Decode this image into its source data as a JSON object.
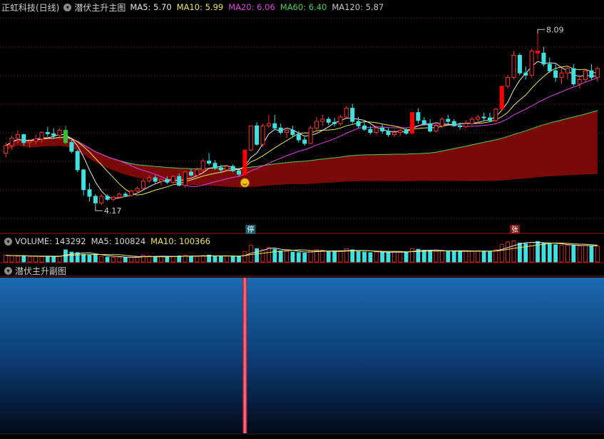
{
  "header": {
    "title": "正虹科技(日线)",
    "indicator_name": "潜伏主升主图",
    "ma_labels": [
      {
        "text": "MA5: 5.70",
        "color": "#e8e8e8"
      },
      {
        "text": "MA10: 5.99",
        "color": "#e8e85a"
      },
      {
        "text": "MA20: 6.06",
        "color": "#e040e0"
      },
      {
        "text": "MA60: 6.40",
        "color": "#50d050"
      },
      {
        "text": "MA120: 5.87",
        "color": "#c8c8c8"
      }
    ]
  },
  "volume_header": {
    "volume": "VOLUME: 143292",
    "ma5": "MA5: 100824",
    "ma10": "MA10: 100366"
  },
  "sub_header": {
    "name": "潜伏主升副图"
  },
  "annotations": {
    "high_label": "8.09",
    "low_label": "4.17",
    "stop_marker": "停",
    "rise_marker": "张"
  },
  "colors": {
    "up": "#ff3030",
    "down": "#40e0e0",
    "limit_up": "#ff0000",
    "limit_down": "#30c030",
    "ma5": "#e8e8e8",
    "ma10": "#e8e85a",
    "ma20": "#e040e0",
    "ma60": "#50d050",
    "band_fill": "#7a0a0a",
    "background": "#000000"
  },
  "chart_data": {
    "type": "candlestick",
    "price_range": [
      3.8,
      8.5
    ],
    "candles": [
      [
        5.38,
        5.62,
        5.28,
        5.55
      ],
      [
        5.55,
        5.78,
        5.46,
        5.72
      ],
      [
        5.72,
        5.9,
        5.6,
        5.8
      ],
      [
        5.8,
        5.82,
        5.55,
        5.62
      ],
      [
        5.62,
        5.7,
        5.5,
        5.65
      ],
      [
        5.65,
        5.8,
        5.58,
        5.7
      ],
      [
        5.7,
        5.88,
        5.62,
        5.85
      ],
      [
        5.85,
        5.98,
        5.75,
        5.82
      ],
      [
        5.82,
        5.95,
        5.7,
        5.78
      ],
      [
        5.78,
        5.95,
        5.7,
        5.9
      ],
      [
        5.9,
        6.0,
        5.58,
        5.62
      ],
      [
        5.62,
        5.68,
        5.38,
        5.42
      ],
      [
        5.42,
        5.45,
        4.95,
        5.0
      ],
      [
        5.0,
        5.02,
        4.42,
        4.55
      ],
      [
        4.55,
        4.7,
        4.28,
        4.4
      ],
      [
        4.4,
        4.45,
        4.17,
        4.25
      ],
      [
        4.25,
        4.45,
        4.2,
        4.4
      ],
      [
        4.4,
        4.45,
        4.3,
        4.33
      ],
      [
        4.33,
        4.4,
        4.28,
        4.38
      ],
      [
        4.38,
        4.48,
        4.35,
        4.45
      ],
      [
        4.45,
        4.5,
        4.38,
        4.42
      ],
      [
        4.42,
        4.55,
        4.4,
        4.52
      ],
      [
        4.52,
        4.62,
        4.46,
        4.58
      ],
      [
        4.58,
        4.8,
        4.55,
        4.75
      ],
      [
        4.75,
        4.88,
        4.7,
        4.82
      ],
      [
        4.82,
        4.88,
        4.7,
        4.74
      ],
      [
        4.74,
        4.8,
        4.65,
        4.78
      ],
      [
        4.78,
        4.85,
        4.68,
        4.72
      ],
      [
        4.72,
        4.88,
        4.68,
        4.85
      ],
      [
        4.85,
        4.92,
        4.62,
        4.65
      ],
      [
        4.65,
        4.98,
        4.6,
        4.95
      ],
      [
        4.95,
        5.02,
        4.85,
        4.88
      ],
      [
        4.88,
        5.05,
        4.82,
        5.0
      ],
      [
        5.0,
        5.25,
        4.95,
        5.2
      ],
      [
        5.2,
        5.38,
        5.1,
        5.15
      ],
      [
        5.15,
        5.22,
        5.0,
        5.05
      ],
      [
        5.05,
        5.12,
        4.95,
        5.0
      ],
      [
        5.0,
        5.1,
        4.98,
        5.08
      ],
      [
        5.08,
        5.12,
        4.95,
        4.98
      ],
      [
        4.98,
        5.02,
        4.85,
        4.9
      ],
      [
        4.9,
        5.45,
        4.88,
        5.45
      ],
      [
        5.45,
        6.0,
        5.42,
        6.0
      ],
      [
        6.0,
        6.08,
        5.55,
        5.58
      ],
      [
        5.58,
        6.05,
        5.52,
        6.0
      ],
      [
        6.0,
        6.25,
        5.95,
        6.05
      ],
      [
        6.05,
        6.25,
        5.9,
        5.95
      ],
      [
        5.95,
        6.05,
        5.8,
        5.85
      ],
      [
        5.85,
        5.95,
        5.72,
        5.9
      ],
      [
        5.9,
        6.0,
        5.75,
        5.8
      ],
      [
        5.8,
        5.88,
        5.62,
        5.68
      ],
      [
        5.68,
        5.75,
        5.55,
        5.6
      ],
      [
        5.6,
        6.0,
        5.58,
        5.95
      ],
      [
        5.95,
        6.2,
        5.9,
        6.1
      ],
      [
        6.1,
        6.25,
        6.0,
        6.15
      ],
      [
        6.15,
        6.2,
        6.02,
        6.08
      ],
      [
        6.08,
        6.18,
        5.98,
        6.05
      ],
      [
        6.05,
        6.25,
        6.0,
        6.2
      ],
      [
        6.2,
        6.45,
        6.15,
        6.4
      ],
      [
        6.4,
        6.5,
        6.05,
        6.1
      ],
      [
        6.1,
        6.2,
        5.95,
        6.0
      ],
      [
        6.0,
        6.08,
        5.88,
        5.92
      ],
      [
        5.92,
        6.0,
        5.8,
        5.85
      ],
      [
        5.85,
        6.0,
        5.8,
        5.95
      ],
      [
        5.95,
        6.05,
        5.82,
        5.88
      ],
      [
        5.88,
        5.95,
        5.75,
        5.8
      ],
      [
        5.8,
        5.92,
        5.75,
        5.85
      ],
      [
        5.85,
        5.98,
        5.78,
        5.9
      ],
      [
        5.9,
        5.95,
        5.8,
        5.83
      ],
      [
        5.83,
        6.3,
        5.8,
        6.3
      ],
      [
        6.3,
        6.4,
        6.05,
        6.12
      ],
      [
        6.12,
        6.2,
        6.0,
        6.05
      ],
      [
        6.05,
        6.15,
        5.85,
        5.88
      ],
      [
        5.88,
        6.05,
        5.85,
        6.0
      ],
      [
        6.0,
        6.2,
        5.95,
        6.15
      ],
      [
        6.15,
        6.25,
        6.02,
        6.1
      ],
      [
        6.1,
        6.15,
        5.98,
        6.0
      ],
      [
        6.0,
        6.08,
        5.92,
        5.98
      ],
      [
        5.98,
        6.12,
        5.95,
        6.05
      ],
      [
        6.05,
        6.2,
        6.0,
        6.15
      ],
      [
        6.15,
        6.25,
        6.05,
        6.2
      ],
      [
        6.2,
        6.3,
        6.1,
        6.18
      ],
      [
        6.18,
        6.3,
        6.1,
        6.12
      ],
      [
        6.12,
        6.4,
        6.08,
        6.38
      ],
      [
        6.38,
        6.9,
        6.35,
        6.9
      ],
      [
        6.9,
        7.15,
        6.85,
        7.1
      ],
      [
        7.1,
        7.7,
        7.05,
        7.6
      ],
      [
        7.6,
        7.65,
        7.15,
        7.2
      ],
      [
        7.2,
        7.35,
        7.05,
        7.15
      ],
      [
        7.15,
        7.75,
        7.1,
        7.7
      ],
      [
        7.7,
        8.09,
        7.5,
        7.65
      ],
      [
        7.65,
        7.8,
        7.35,
        7.4
      ],
      [
        7.4,
        7.55,
        7.2,
        7.25
      ],
      [
        7.25,
        7.4,
        7.0,
        7.1
      ],
      [
        7.1,
        7.3,
        6.95,
        7.2
      ],
      [
        7.2,
        7.35,
        7.05,
        7.3
      ],
      [
        7.3,
        7.4,
        6.9,
        6.95
      ],
      [
        6.95,
        7.15,
        6.85,
        7.05
      ],
      [
        7.05,
        7.3,
        7.0,
        7.25
      ],
      [
        7.25,
        7.4,
        7.05,
        7.1
      ],
      [
        7.1,
        7.35,
        7.0,
        7.3
      ]
    ],
    "special_bars": {
      "limit_down_index": 10,
      "limit_up_indices": [
        40,
        68,
        83,
        89
      ]
    },
    "volume_range": [
      0,
      240000
    ],
    "volume": [
      60000,
      55000,
      52000,
      58000,
      45000,
      50000,
      48000,
      52000,
      47000,
      50000,
      110000,
      90000,
      85000,
      70000,
      60000,
      62000,
      50000,
      45000,
      42000,
      44000,
      40000,
      42000,
      45000,
      60000,
      55000,
      50000,
      48000,
      45000,
      52000,
      55000,
      60000,
      52000,
      50000,
      58000,
      62000,
      55000,
      50000,
      52000,
      48000,
      46000,
      95000,
      150000,
      120000,
      110000,
      130000,
      115000,
      100000,
      95000,
      90000,
      85000,
      80000,
      100000,
      110000,
      105000,
      95000,
      90000,
      100000,
      120000,
      110000,
      95000,
      90000,
      85000,
      90000,
      88000,
      85000,
      90000,
      92000,
      88000,
      120000,
      115000,
      105000,
      100000,
      95000,
      100000,
      98000,
      95000,
      92000,
      95000,
      100000,
      102000,
      98000,
      96000,
      110000,
      160000,
      180000,
      190000,
      170000,
      165000,
      175000,
      185000,
      170000,
      160000,
      155000,
      150000,
      148000,
      150000,
      145000,
      148000,
      142000,
      143292
    ],
    "sub_signal_index": 40
  }
}
